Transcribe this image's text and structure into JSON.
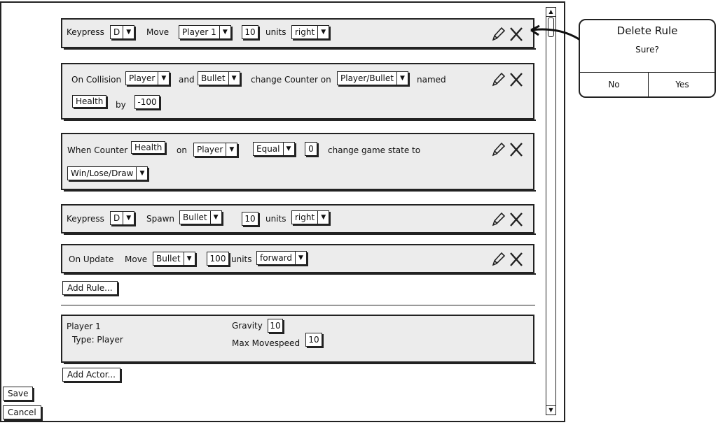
{
  "rules": {
    "r1": {
      "label1": "Keypress",
      "key": "D",
      "label2": "Move",
      "target": "Player 1",
      "amount": "10",
      "label3": "units",
      "dir": "right"
    },
    "r2": {
      "label1": "On Collision",
      "obj1": "Player",
      "label2": "and",
      "obj2": "Bullet",
      "label3": "change Counter on",
      "target": "Player/Bullet",
      "label4": "named",
      "counter": "Health",
      "label5": "by",
      "amount": "-100"
    },
    "r3": {
      "label1": "When Counter",
      "counter": "Health",
      "label2": "on",
      "target": "Player",
      "cmp": "Equal",
      "value": "0",
      "label3": "change game state to",
      "state": "Win/Lose/Draw"
    },
    "r4": {
      "label1": "Keypress",
      "key": "D",
      "label2": "Spawn",
      "obj": "Bullet",
      "amount": "10",
      "label3": "units",
      "dir": "right"
    },
    "r5": {
      "label1": "On Update",
      "label2": "Move",
      "obj": "Bullet",
      "amount": "100",
      "label3": "units",
      "dir": "forward"
    }
  },
  "add_rule_label": "Add Rule...",
  "actor": {
    "name": "Player 1",
    "type": "Type: Player",
    "gravity_label": "Gravity",
    "gravity": "10",
    "speed_label": "Max Movespeed",
    "speed": "10"
  },
  "add_actor_label": "Add Actor...",
  "save_label": "Save",
  "cancel_label": "Cancel",
  "dialog": {
    "title": "Delete Rule",
    "message": "Sure?",
    "no": "No",
    "yes": "Yes"
  },
  "colors": {
    "panel": "#ececec",
    "stroke": "#222222"
  }
}
